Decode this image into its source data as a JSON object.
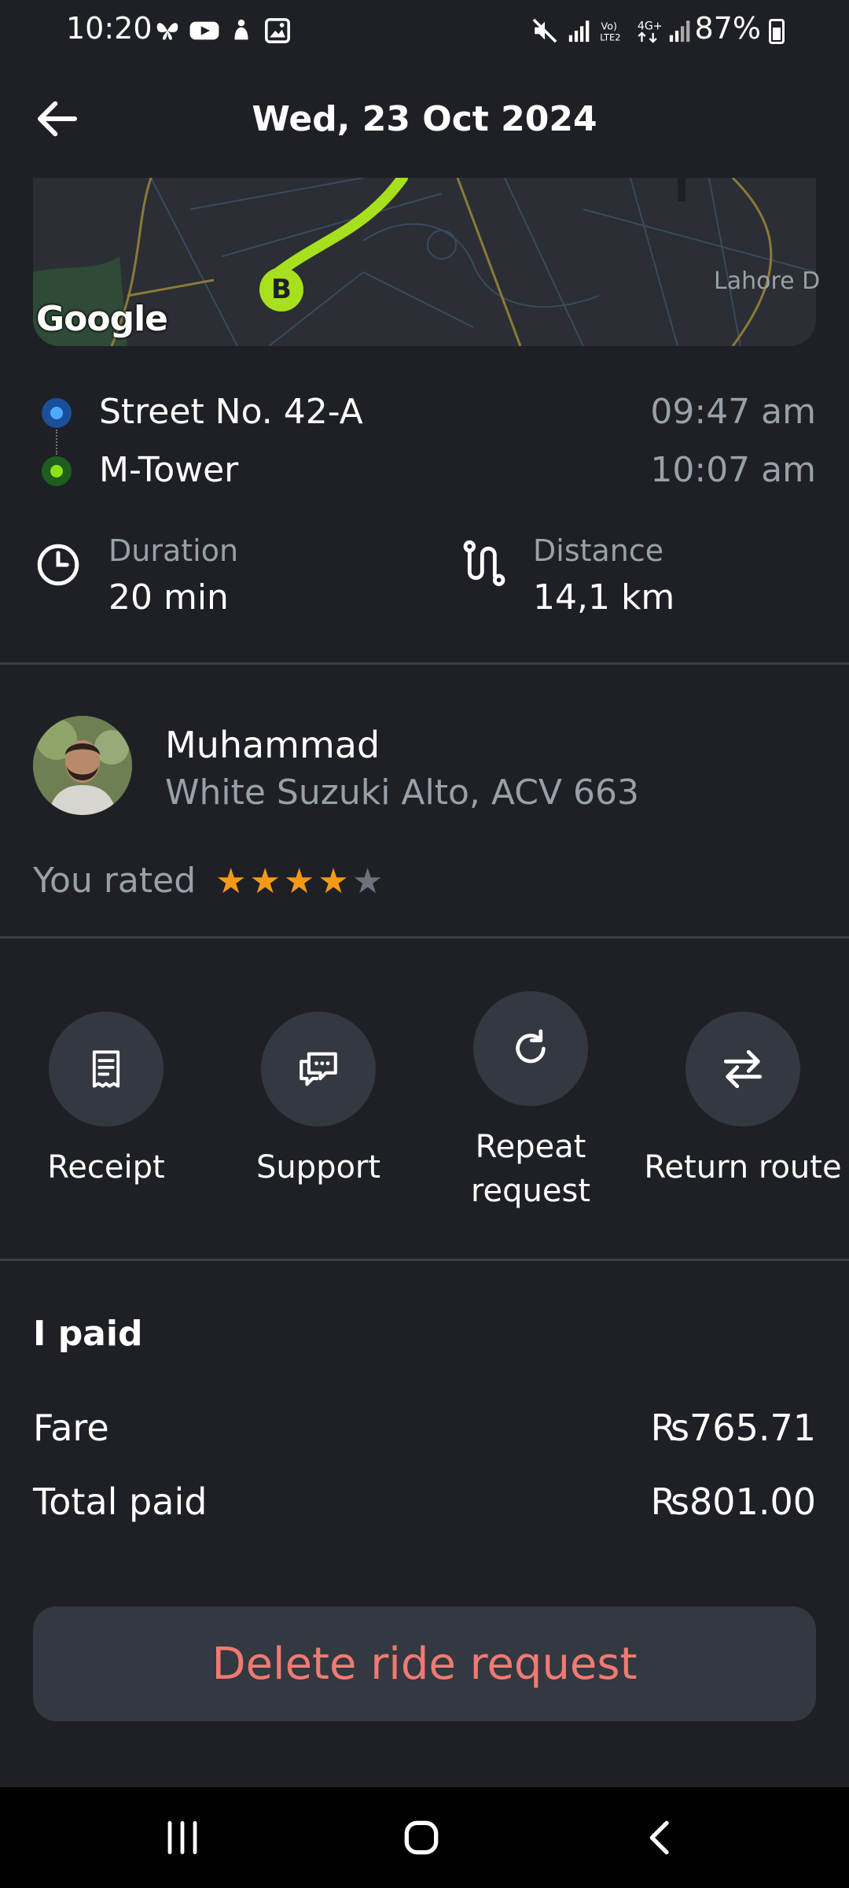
{
  "status_bar": {
    "time": "10:20",
    "battery": "87%",
    "icons": [
      "butterfly-icon",
      "youtube-icon",
      "notification-icon",
      "gallery-icon",
      "mute-icon",
      "signal-icon",
      "volte-icon",
      "4g-icon",
      "signal-icon",
      "battery-icon"
    ]
  },
  "header": {
    "title": "Wed, 23 Oct 2024",
    "back_icon": "arrow-left-icon"
  },
  "map": {
    "marker": "B",
    "attribution": "Google",
    "label": "Lahore D"
  },
  "route": {
    "pickup": {
      "name": "Street No. 42-A",
      "time": "09:47 am"
    },
    "dropoff": {
      "name": "M-Tower",
      "time": "10:07 am"
    }
  },
  "stats": {
    "duration": {
      "label": "Duration",
      "value": "20 min"
    },
    "distance": {
      "label": "Distance",
      "value": "14,1 km"
    }
  },
  "driver": {
    "name": "Muhammad",
    "car": "White Suzuki Alto, ACV 663",
    "rated_label": "You rated",
    "rating": 4,
    "rating_max": 5
  },
  "actions": [
    {
      "label": "Receipt",
      "icon": "receipt-icon"
    },
    {
      "label": "Support",
      "icon": "chat-icon"
    },
    {
      "label": "Repeat request",
      "icon": "refresh-icon"
    },
    {
      "label": "Return route",
      "icon": "swap-arrows-icon"
    }
  ],
  "payment": {
    "title": "I paid",
    "rows": [
      {
        "label": "Fare",
        "value": "₨765.71"
      },
      {
        "label": "Total paid",
        "value": "₨801.00"
      }
    ]
  },
  "delete_button": "Delete ride request",
  "colors": {
    "background": "#1e2026",
    "surface": "#343840",
    "accent_green": "#a7e01d",
    "danger": "#f07a73",
    "star": "#f59a16"
  }
}
